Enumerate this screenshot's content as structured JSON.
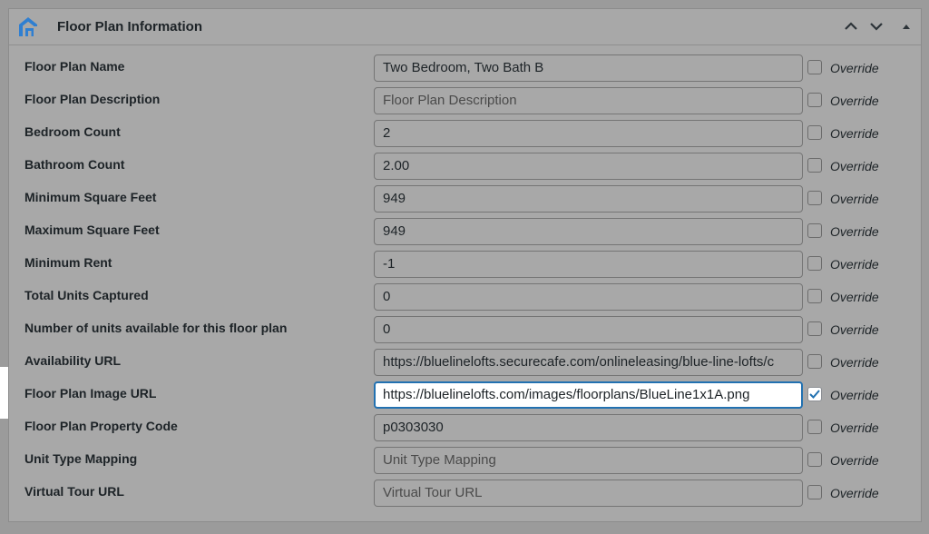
{
  "panel": {
    "title": "Floor Plan Information",
    "controls": [
      "chevron-up-icon",
      "chevron-down-icon",
      "collapse-triangle-icon"
    ]
  },
  "brand": {
    "color": "#2f7fd1",
    "accent": "#2271b1"
  },
  "override_label": "Override",
  "fields": [
    {
      "label": "Floor Plan Name",
      "value": "Two Bedroom, Two Bath B",
      "placeholder": "",
      "override": false
    },
    {
      "label": "Floor Plan Description",
      "value": "",
      "placeholder": "Floor Plan Description",
      "override": false
    },
    {
      "label": "Bedroom Count",
      "value": "2",
      "placeholder": "",
      "override": false
    },
    {
      "label": "Bathroom Count",
      "value": "2.00",
      "placeholder": "",
      "override": false
    },
    {
      "label": "Minimum Square Feet",
      "value": "949",
      "placeholder": "",
      "override": false
    },
    {
      "label": "Maximum Square Feet",
      "value": "949",
      "placeholder": "",
      "override": false
    },
    {
      "label": "Minimum Rent",
      "value": "-1",
      "placeholder": "",
      "override": false
    },
    {
      "label": "Total Units Captured",
      "value": "0",
      "placeholder": "",
      "override": false
    },
    {
      "label": "Number of units available for this floor plan",
      "value": "0",
      "placeholder": "",
      "override": false
    },
    {
      "label": "Availability URL",
      "value": "https://bluelinelofts.securecafe.com/onlineleasing/blue-line-lofts/c",
      "placeholder": "",
      "override": false
    },
    {
      "label": "Floor Plan Image URL",
      "value": "https://bluelinelofts.com/images/floorplans/BlueLine1x1A.png",
      "placeholder": "",
      "override": true
    },
    {
      "label": "Floor Plan Property Code",
      "value": "p0303030",
      "placeholder": "",
      "override": false
    },
    {
      "label": "Unit Type Mapping",
      "value": "",
      "placeholder": "Unit Type Mapping",
      "override": false
    },
    {
      "label": "Virtual Tour URL",
      "value": "",
      "placeholder": "Virtual Tour URL",
      "override": false
    }
  ]
}
